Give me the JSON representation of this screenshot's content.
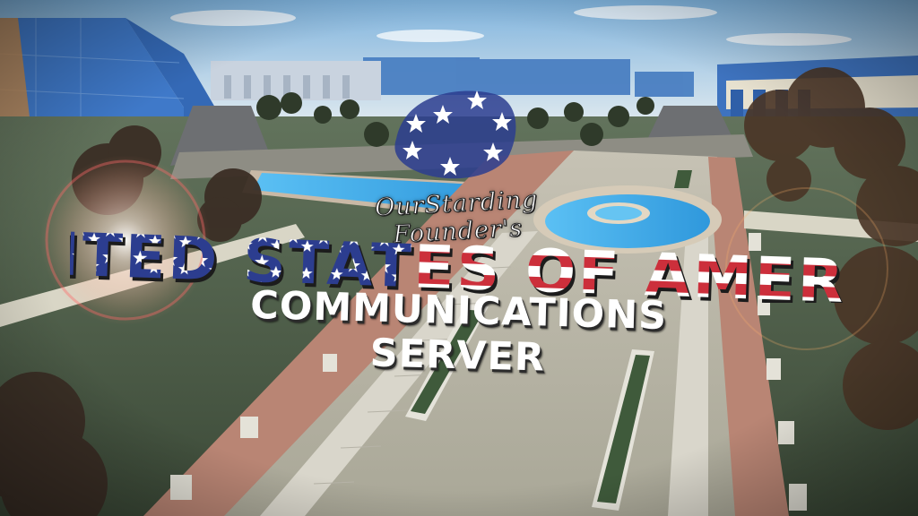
{
  "banner": {
    "script_text": "OurStarding Founder's",
    "title_text": "UNITED STATES OF AMERICA",
    "subtitle_text": "COMMUNICATIONS SERVER"
  },
  "colors": {
    "flag_blue": "#2c3d8f",
    "flag_red": "#cc2f3b",
    "flag_white": "#ffffff",
    "sky": "#8fb8d8",
    "grass": "#52604a",
    "brick": "#b87d6e",
    "water": "#3ea7e8"
  },
  "icons": [
    "flag-star-emblem-icon",
    "lens-flare-icon"
  ]
}
